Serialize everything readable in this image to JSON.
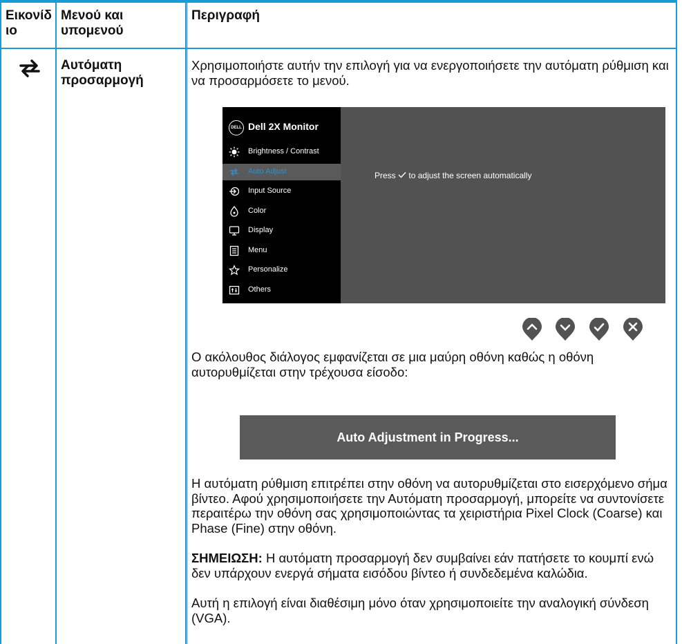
{
  "header": {
    "col_icon": "Εικονίδιο",
    "col_menu": "Μενού και υπομενού",
    "col_desc": "Περιγραφή"
  },
  "row": {
    "icon_name": "auto-adjust-icon",
    "menu_label": "Αυτόματη προσαρμογή",
    "intro": "Χρησιμοποιήστε αυτήν την επιλογή για να ενεργοποιήσετε την αυτόματη ρύθμιση και να προσαρμόσετε το μενού.",
    "osd": {
      "logo": "DELL",
      "title": "Dell 2X Monitor",
      "items": [
        {
          "label": "Brightness / Contrast",
          "icon": "brightness-icon"
        },
        {
          "label": "Auto Adjust",
          "icon": "auto-adjust-icon",
          "active": true
        },
        {
          "label": "Input Source",
          "icon": "input-source-icon"
        },
        {
          "label": "Color",
          "icon": "color-icon"
        },
        {
          "label": "Display",
          "icon": "display-icon"
        },
        {
          "label": "Menu",
          "icon": "menu-icon"
        },
        {
          "label": "Personalize",
          "icon": "star-icon"
        },
        {
          "label": "Others",
          "icon": "others-icon"
        }
      ],
      "message_pre": "Press",
      "message_post": "to adjust the screen automatically",
      "accent_color": "#2f8fd1"
    },
    "buttons": [
      "up-icon",
      "down-icon",
      "check-icon",
      "close-icon"
    ],
    "dialog_intro": "Ο ακόλουθος διάλογος εμφανίζεται σε μια μαύρη οθόνη καθώς η οθόνη αυτορυθμίζεται στην τρέχουσα είσοδο:",
    "progress_label": "Auto Adjustment in Progress...",
    "body": "Η αυτόματη ρύθμιση επιτρέπει στην οθόνη να αυτορυθμίζεται στο εισερχόμενο σήμα βίντεο. Αφού χρησιμοποιήσετε την Αυτόματη προσαρμογή, μπορείτε να συντονίσετε περαιτέρω την οθόνη σας χρησιμοποιώντας τα χειριστήρια Pixel Clock (Coarse) και Phase (Fine) στην οθόνη.",
    "note_label": "ΣΗΜΕΙΩΣΗ:",
    "note_text": "Η αυτόματη προσαρμογή δεν συμβαίνει εάν πατήσετε το κουμπί ενώ δεν υπάρχουν ενεργά σήματα εισόδου βίντεο ή συνδεδεμένα καλώδια.",
    "vga_note": "Αυτή η επιλογή είναι διαθέσιμη μόνο όταν χρησιμοποιείτε την αναλογική σύνδεση (VGA)."
  },
  "colors": {
    "border": "#1a9bd7",
    "osd_bg": "#525252",
    "osd_side": "#000000"
  }
}
